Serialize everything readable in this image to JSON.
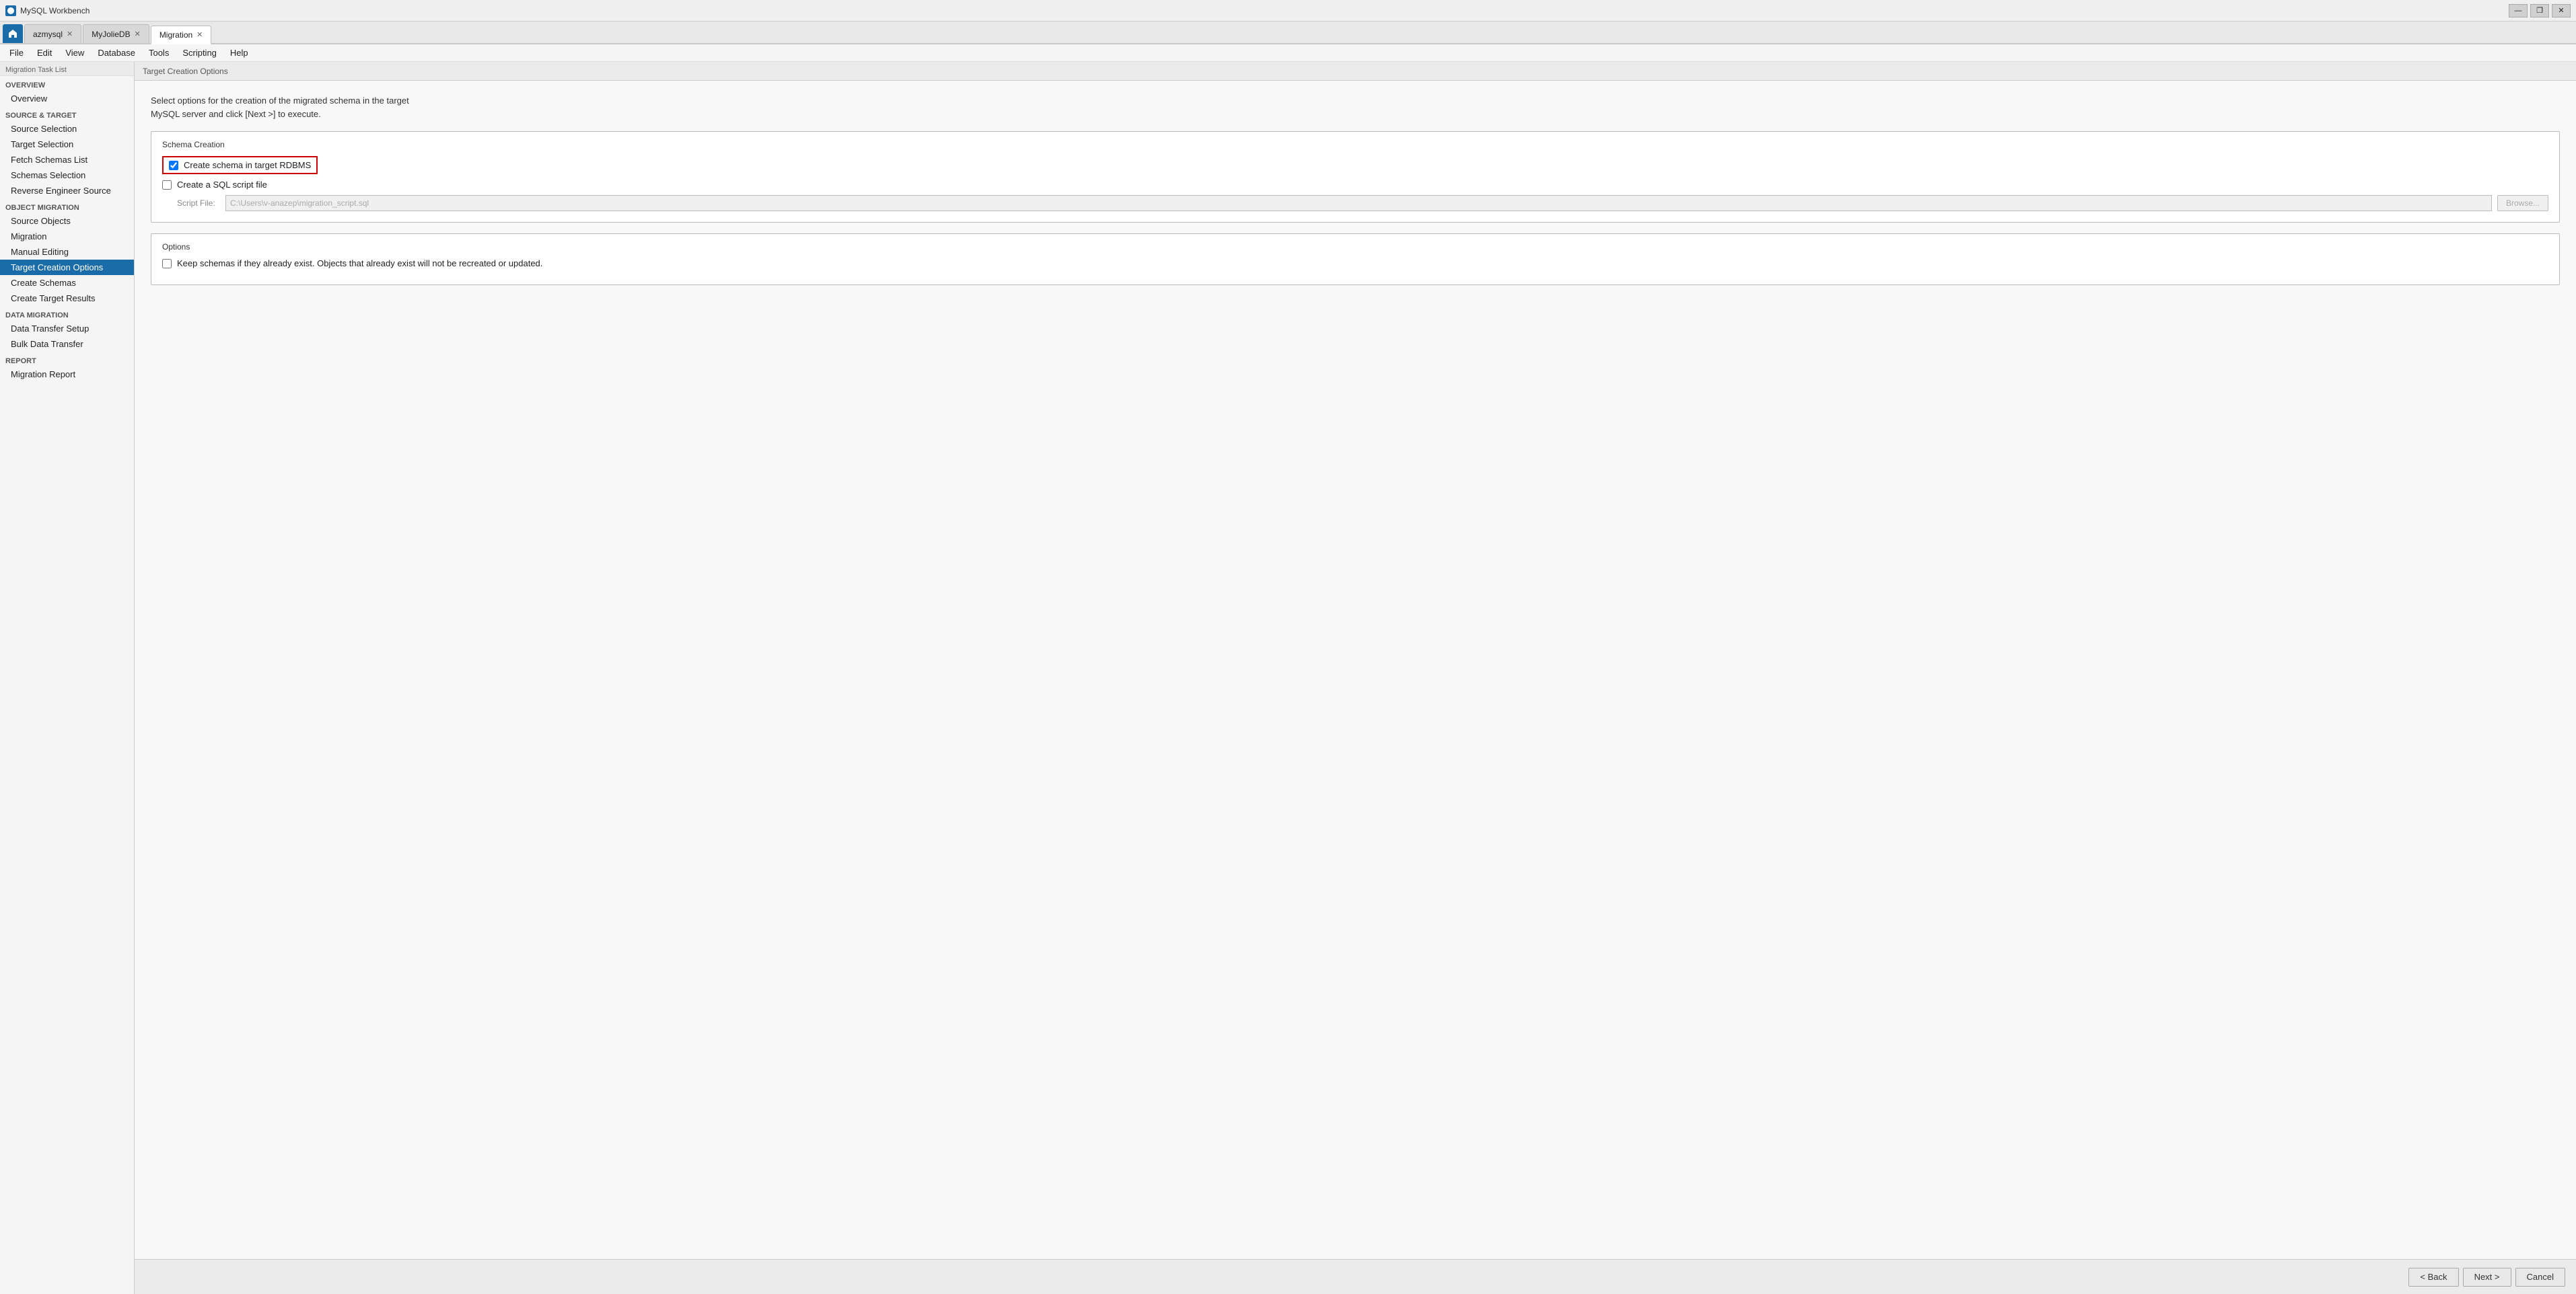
{
  "titlebar": {
    "title": "MySQL Workbench",
    "controls": {
      "minimize": "—",
      "maximize": "❐",
      "close": "✕"
    }
  },
  "tabs": [
    {
      "id": "azmysql",
      "label": "azmysql",
      "closable": true,
      "active": false
    },
    {
      "id": "myjoliedb",
      "label": "MyJolieDB",
      "closable": true,
      "active": false
    },
    {
      "id": "migration",
      "label": "Migration",
      "closable": true,
      "active": true
    }
  ],
  "menubar": {
    "items": [
      "File",
      "Edit",
      "View",
      "Database",
      "Tools",
      "Scripting",
      "Help"
    ]
  },
  "sidebar": {
    "header": "Migration Task List",
    "sections": [
      {
        "label": "OVERVIEW",
        "items": [
          "Overview"
        ]
      },
      {
        "label": "SOURCE & TARGET",
        "items": [
          "Source Selection",
          "Target Selection",
          "Fetch Schemas List",
          "Schemas Selection",
          "Reverse Engineer Source"
        ]
      },
      {
        "label": "OBJECT MIGRATION",
        "items": [
          "Source Objects",
          "Migration",
          "Manual Editing",
          "Target Creation Options",
          "Create Schemas",
          "Create Target Results"
        ]
      },
      {
        "label": "DATA MIGRATION",
        "items": [
          "Data Transfer Setup",
          "Bulk Data Transfer"
        ]
      },
      {
        "label": "REPORT",
        "items": [
          "Migration Report"
        ]
      }
    ],
    "active_item": "Target Creation Options"
  },
  "content": {
    "header": "Target Creation Options",
    "description_line1": "Select options for the creation of the migrated schema in the target",
    "description_line2": "MySQL server and click [Next >] to execute.",
    "schema_creation": {
      "group_title": "Schema Creation",
      "create_schema_checked": true,
      "create_schema_label": "Create schema in target RDBMS",
      "create_sql_checked": false,
      "create_sql_label": "Create a SQL script file",
      "script_file_label": "Script File:",
      "script_file_value": "C:\\Users\\v-anazep\\migration_script.sql",
      "browse_label": "Browse..."
    },
    "options": {
      "group_title": "Options",
      "keep_schemas_checked": false,
      "keep_schemas_label": "Keep schemas if they already exist. Objects that already exist will not be recreated or updated."
    }
  },
  "bottom_bar": {
    "back_label": "< Back",
    "next_label": "Next >",
    "cancel_label": "Cancel"
  }
}
